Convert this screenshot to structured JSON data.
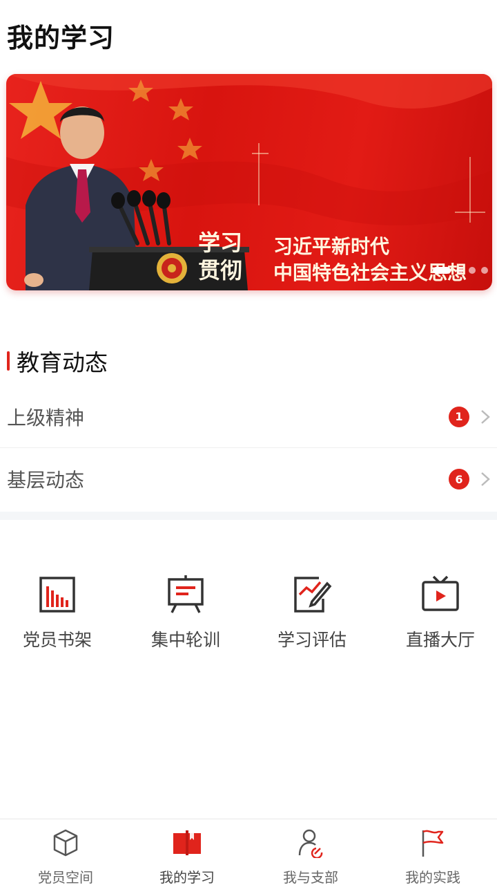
{
  "header": {
    "title": "我的学习"
  },
  "banner": {
    "tag": "学习贯彻",
    "line1": "习近平新时代",
    "line2": "中国特色社会主义思想",
    "slide_count": 4,
    "active_slide": 1
  },
  "education": {
    "title": "教育动态",
    "items": [
      {
        "label": "上级精神",
        "badge": "1"
      },
      {
        "label": "基层动态",
        "badge": "6"
      }
    ]
  },
  "quick_actions": [
    {
      "label": "党员书架",
      "icon": "bookshelf-icon"
    },
    {
      "label": "集中轮训",
      "icon": "training-board-icon"
    },
    {
      "label": "学习评估",
      "icon": "assessment-icon"
    },
    {
      "label": "直播大厅",
      "icon": "live-tv-icon"
    }
  ],
  "tabbar": {
    "active": 1,
    "items": [
      {
        "label": "党员空间",
        "icon": "cube-icon"
      },
      {
        "label": "我的学习",
        "icon": "book-icon"
      },
      {
        "label": "我与支部",
        "icon": "member-icon"
      },
      {
        "label": "我的实践",
        "icon": "flag-icon"
      }
    ]
  },
  "colors": {
    "accent": "#e0241c",
    "banner_red": "#d8140f",
    "text_gold": "#fff6e0"
  }
}
